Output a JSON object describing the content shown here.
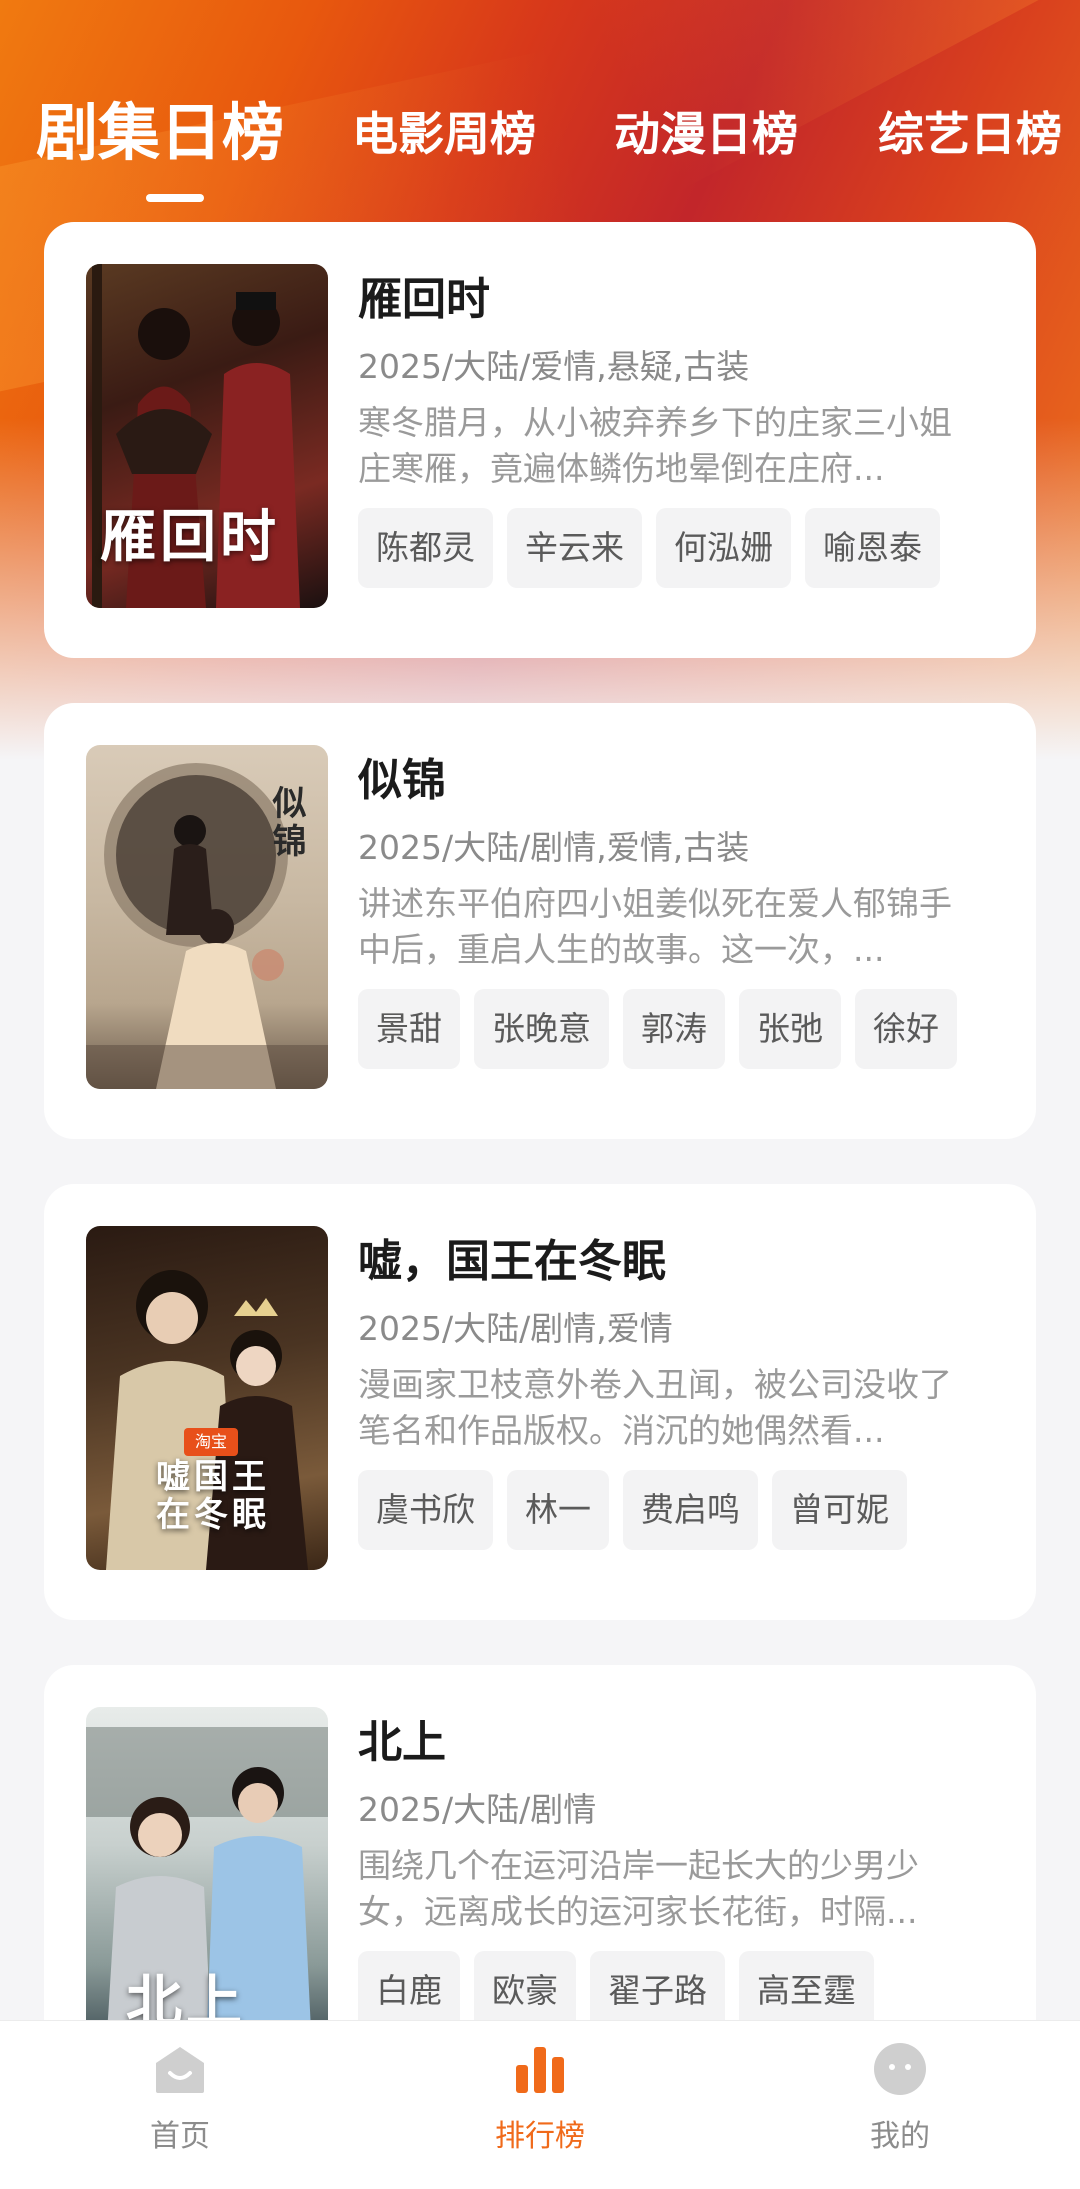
{
  "tabs": [
    {
      "label": "剧集日榜",
      "active": true
    },
    {
      "label": "电影周榜",
      "active": false
    },
    {
      "label": "动漫日榜",
      "active": false
    },
    {
      "label": "综艺日榜",
      "active": false
    }
  ],
  "shows": [
    {
      "title": "雁回时",
      "poster_text": "雁回时",
      "meta": "2025/大陆/爱情,悬疑,古装",
      "desc": "寒冬腊月，从小被弃养乡下的庄家三小姐庄寒雁，竟遍体鳞伤地晕倒在庄府...",
      "cast": [
        "陈都灵",
        "辛云来",
        "何泓姗",
        "喻恩泰"
      ],
      "poster_colors": [
        "#3a1b14",
        "#7a2a22",
        "#1a1a1a"
      ]
    },
    {
      "title": "似锦",
      "poster_text": "似锦",
      "meta": "2025/大陆/剧情,爱情,古装",
      "desc": "讲述东平伯府四小姐姜似死在爱人郁锦手中后，重启人生的故事。这一次，...",
      "cast": [
        "景甜",
        "张晚意",
        "郭涛",
        "张弛",
        "徐好"
      ],
      "poster_colors": [
        "#d9cbb8",
        "#a89580",
        "#5a4a40"
      ]
    },
    {
      "title": "嘘，国王在冬眠",
      "poster_text": "嘘国王在冬眠",
      "meta": "2025/大陆/剧情,爱情",
      "desc": "漫画家卫枝意外卷入丑闻，被公司没收了笔名和作品版权。消沉的她偶然看...",
      "cast": [
        "虞书欣",
        "林一",
        "费启鸣",
        "曾可妮"
      ],
      "poster_colors": [
        "#2a1a12",
        "#7a5a3a",
        "#c9a070"
      ]
    },
    {
      "title": "北上",
      "poster_text": "北上",
      "meta": "2025/大陆/剧情",
      "desc": "围绕几个在运河沿岸一起长大的少男少女，远离成长的运河家长花街，时隔...",
      "cast": [
        "白鹿",
        "欧豪",
        "翟子路",
        "高至霆"
      ],
      "poster_colors": [
        "#dfe3e2",
        "#8a9a98",
        "#3a4a50"
      ]
    }
  ],
  "bottom_nav": [
    {
      "label": "首页",
      "icon": "home-icon",
      "active": false
    },
    {
      "label": "排行榜",
      "icon": "ranking-icon",
      "active": true
    },
    {
      "label": "我的",
      "icon": "profile-icon",
      "active": false
    }
  ],
  "colors": {
    "accent": "#f06a1a",
    "header_start": "#f07a10",
    "header_mid": "#c2262a"
  }
}
